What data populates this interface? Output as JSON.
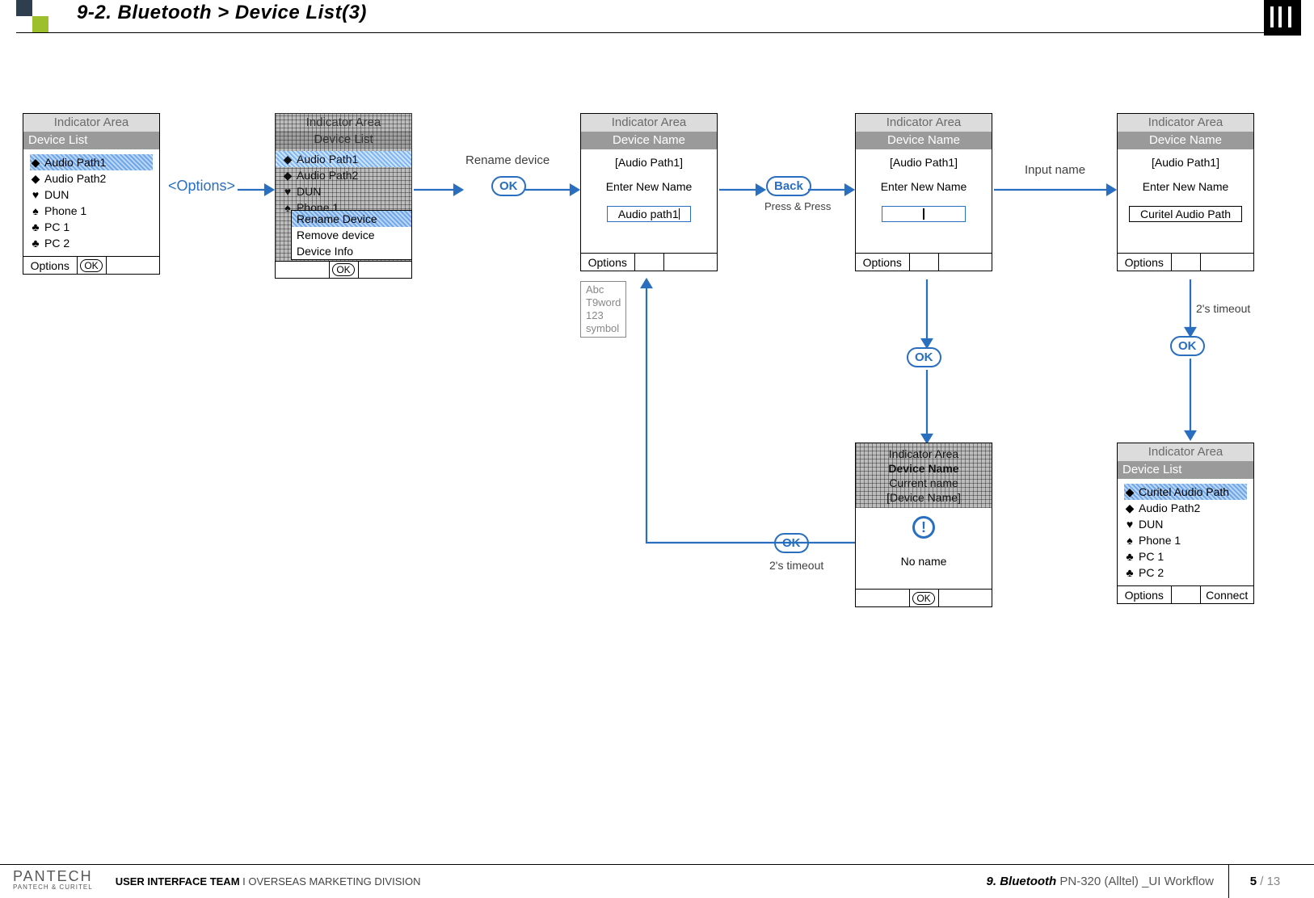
{
  "header": {
    "title": "9-2. Bluetooth > Device List(3)"
  },
  "common": {
    "indicator": "Indicator Area",
    "ok": "OK",
    "options": "Options",
    "connect": "Connect"
  },
  "screen1": {
    "title": "Device List",
    "items": [
      {
        "icon": "◆",
        "label": "Audio Path1",
        "selected": true
      },
      {
        "icon": "◆",
        "label": "Audio Path2"
      },
      {
        "icon": "♥",
        "label": "DUN"
      },
      {
        "icon": "♠",
        "label": "Phone 1"
      },
      {
        "icon": "♣",
        "label": "PC 1"
      },
      {
        "icon": "♣",
        "label": "PC 2"
      }
    ]
  },
  "transition_options_label": "<Options>",
  "screen2_ghost": {
    "title": "Device List",
    "items": [
      {
        "icon": "◆",
        "label": "Audio Path1",
        "selected": true
      },
      {
        "icon": "◆",
        "label": "Audio Path2"
      },
      {
        "icon": "♥",
        "label": "DUN"
      },
      {
        "icon": "♠",
        "label": "Phone 1"
      }
    ],
    "popup": {
      "items": [
        "Rename Device",
        "Remove device",
        "Device Info"
      ],
      "selected_index": 0
    }
  },
  "label_rename": "Rename device",
  "badge_ok_1": "OK",
  "screen3": {
    "title": "Device Name",
    "current_bracket": "[Audio Path1]",
    "enter_label": "Enter New Name",
    "input_value": "Audio path1"
  },
  "ime": {
    "lines": [
      "Abc",
      "T9word",
      "123",
      "symbol"
    ]
  },
  "badge_back": "Back",
  "label_press": "Press & Press",
  "screen4": {
    "title": "Device Name",
    "current_bracket": "[Audio Path1]",
    "enter_label": "Enter New Name",
    "input_value": ""
  },
  "label_input": "Input name",
  "screen5": {
    "title": "Device Name",
    "current_bracket": "[Audio Path1]",
    "enter_label": "Enter New Name",
    "input_value": "Curitel Audio Path"
  },
  "label_timeout": "2's timeout",
  "badge_ok_right": "OK",
  "badge_ok_mid": "OK",
  "badge_ok_left": "OK",
  "screen_alert": {
    "top_title": "Device Name",
    "top_line1": "Current name",
    "top_line2": "[Device Name]",
    "message": "No name"
  },
  "screen_final": {
    "title": "Device List",
    "items": [
      {
        "icon": "◆",
        "label": "Curitel Audio Path",
        "selected": true
      },
      {
        "icon": "◆",
        "label": "Audio Path2"
      },
      {
        "icon": "♥",
        "label": "DUN"
      },
      {
        "icon": "♠",
        "label": "Phone 1"
      },
      {
        "icon": "♣",
        "label": "PC 1"
      },
      {
        "icon": "♣",
        "label": "PC 2"
      }
    ]
  },
  "footer": {
    "brand": "PANTECH",
    "brand_sub": "PANTECH & CURITEL",
    "team_bold": "USER INTERFACE TEAM",
    "team_sep": "  I  ",
    "team_rest": "OVERSEAS MARKETING DIVISION",
    "section": "9. Bluetooth",
    "doc": " PN-320 (Alltel) _UI Workflow",
    "page_cur": "5",
    "page_sep": " / ",
    "page_tot": "13"
  }
}
